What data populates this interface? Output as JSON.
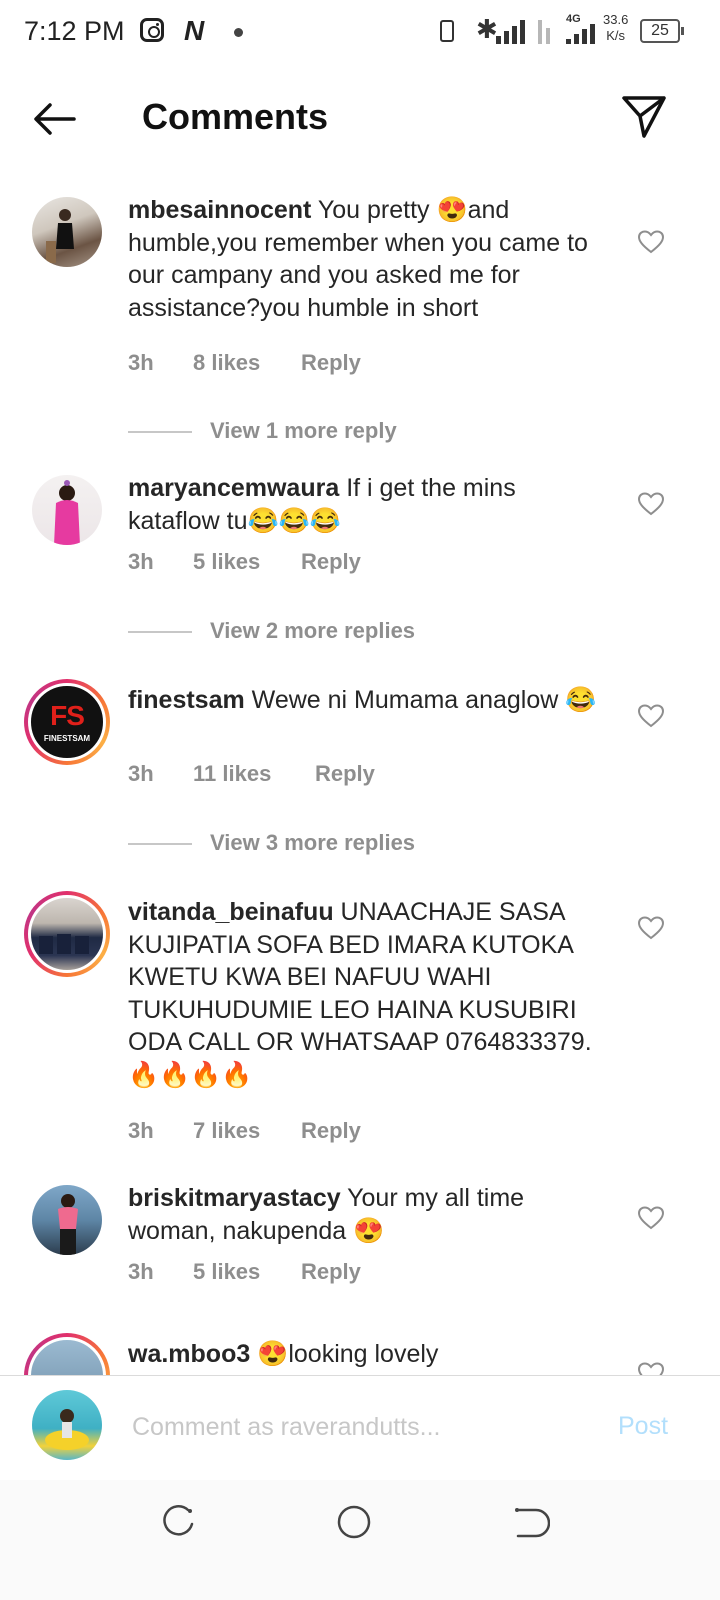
{
  "status_bar": {
    "time": "7:12 PM",
    "network": "4G",
    "speed_value": "33.6",
    "speed_unit": "K/s",
    "battery": "25"
  },
  "header": {
    "title": "Comments"
  },
  "comments": [
    {
      "username": "mbesainnocent",
      "text": "You pretty 😍and humble,you remember when you came to our campany and you asked me for assistance?you humble in short",
      "time": "3h",
      "likes": "8 likes",
      "reply": "Reply",
      "view_replies": "View 1 more reply"
    },
    {
      "username": "maryancemwaura",
      "text": "If i get the mins kataflow tu😂😂😂",
      "time": "3h",
      "likes": "5 likes",
      "reply": "Reply",
      "view_replies": "View 2 more replies"
    },
    {
      "username": "finestsam",
      "text": "Wewe ni Mumama anaglow 😂",
      "time": "3h",
      "likes": "11 likes",
      "reply": "Reply",
      "view_replies": "View 3 more replies",
      "avatar_logo": "FS",
      "avatar_logo_sub": "FINESTSAM"
    },
    {
      "username": "vitanda_beinafuu",
      "text": "UNAACHAJE SASA KUJIPATIA SOFA BED IMARA KUTOKA KWETU KWA BEI NAFUU WAHI TUKUHUDUMIE LEO HAINA KUSUBIRI ODA CALL OR WHATSAAP 0764833379.🔥🔥🔥🔥",
      "time": "3h",
      "likes": "7 likes",
      "reply": "Reply"
    },
    {
      "username": "briskitmaryastacy",
      "text": "Your my all time woman, nakupenda 😍",
      "time": "3h",
      "likes": "5 likes",
      "reply": "Reply"
    },
    {
      "username": "wa.mboo3",
      "text": "😍looking lovely"
    }
  ],
  "input": {
    "placeholder": "Comment as raverandutts...",
    "post_label": "Post"
  },
  "icons": {
    "back": "back-arrow-icon",
    "send": "send-icon",
    "like": "heart-icon",
    "nav_recents": "recents-icon",
    "nav_home": "home-icon",
    "nav_back": "back-icon"
  },
  "colors": {
    "text": "#262626",
    "meta": "#8e8e8e",
    "post_disabled": "#b2dffc",
    "story_ring": "#e1306c"
  }
}
